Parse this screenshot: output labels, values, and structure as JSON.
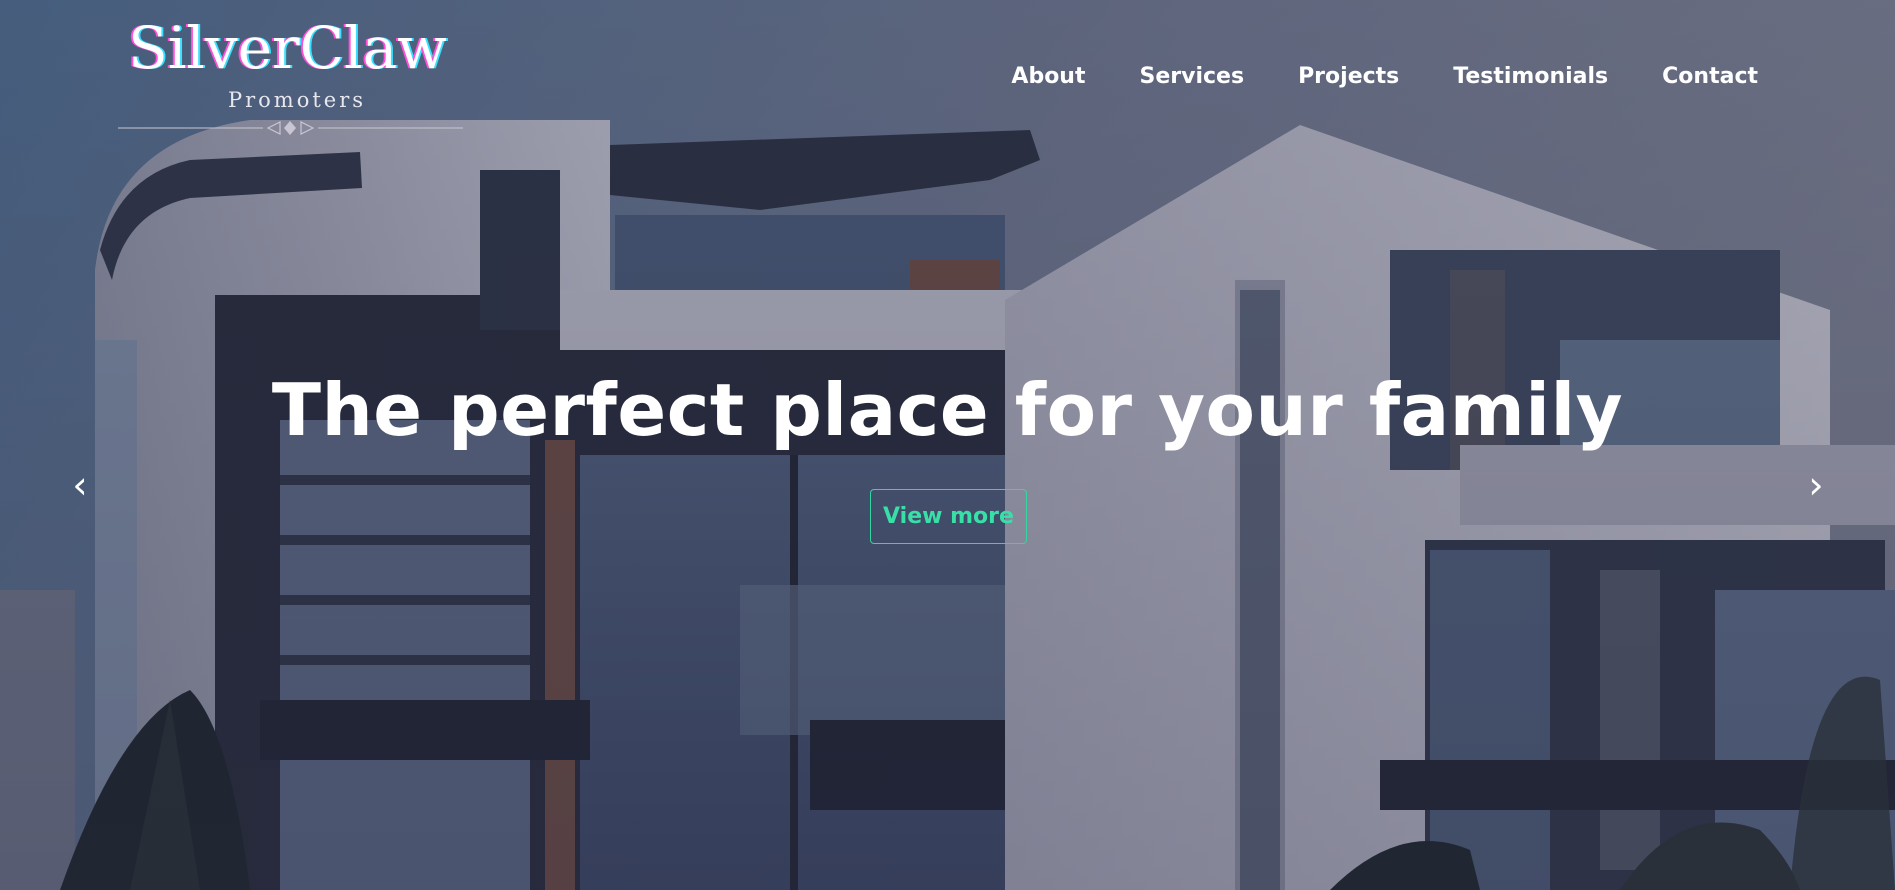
{
  "brand": {
    "name": "SilverClaw",
    "tagline": "Promoters",
    "colors": {
      "magenta": "#ff4fd8",
      "cyan": "#38e1ff"
    }
  },
  "nav": {
    "items": [
      {
        "label": "About"
      },
      {
        "label": "Services"
      },
      {
        "label": "Projects"
      },
      {
        "label": "Testimonials"
      },
      {
        "label": "Contact"
      }
    ]
  },
  "hero": {
    "headline": "The perfect place for your family",
    "cta_label": "View more",
    "cta_color": "#33d6a0",
    "prev_arrow": "‹",
    "next_arrow": "›",
    "background": "modern-house-photo"
  }
}
